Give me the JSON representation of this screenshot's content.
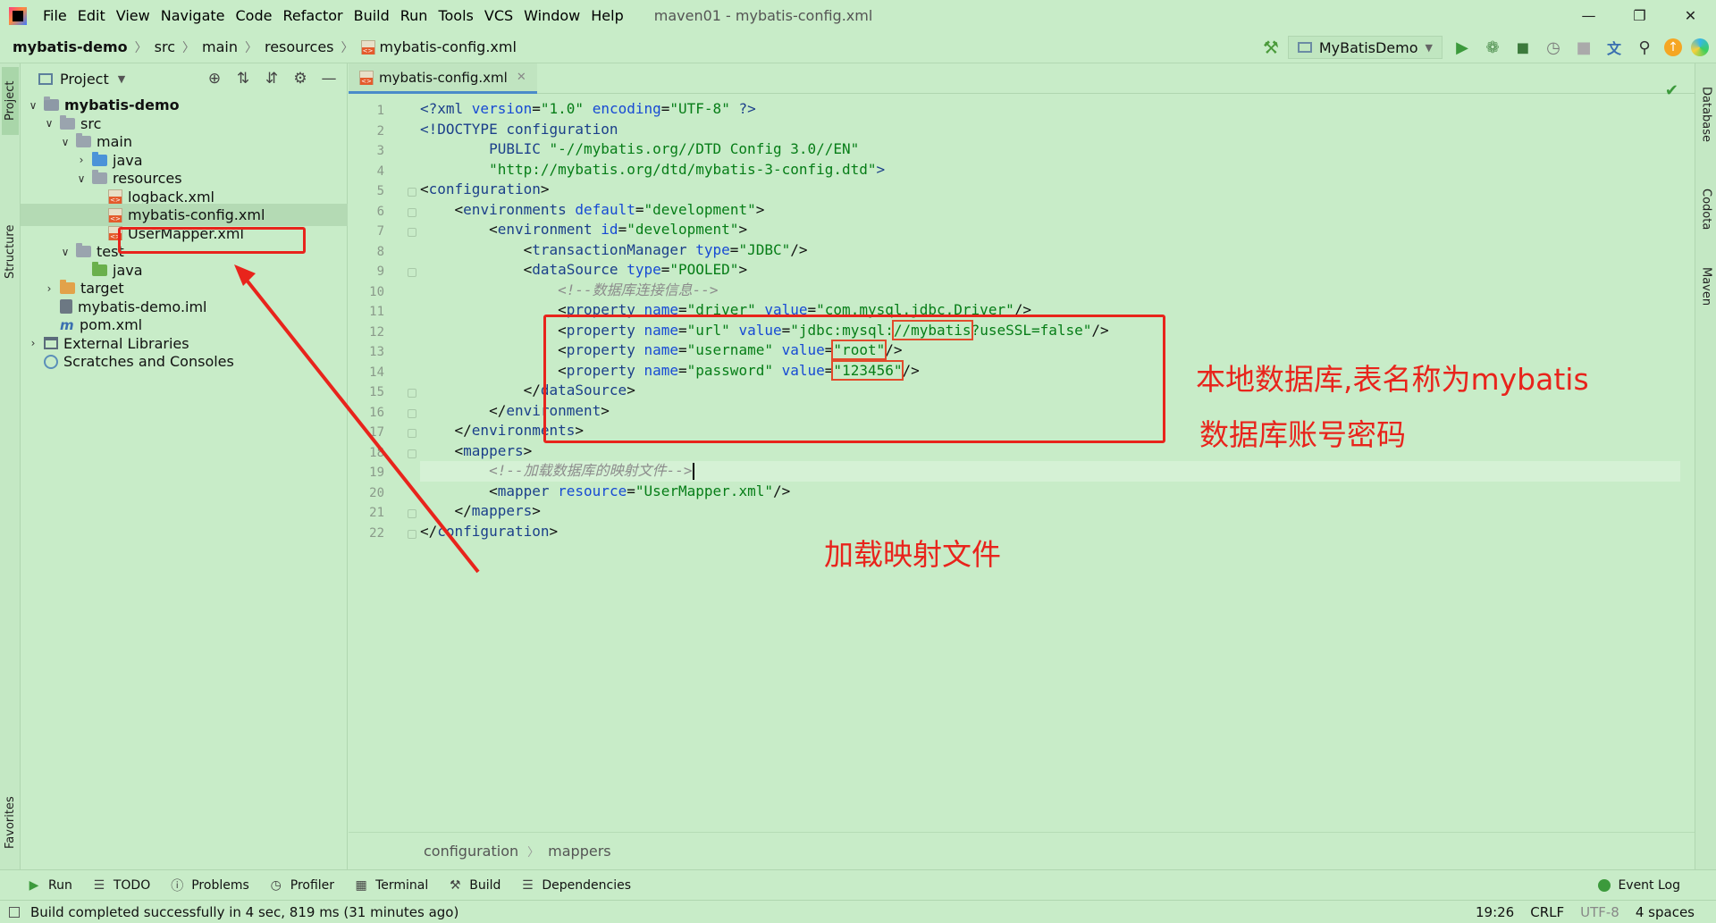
{
  "menubar": {
    "items": [
      "File",
      "Edit",
      "View",
      "Navigate",
      "Code",
      "Refactor",
      "Build",
      "Run",
      "Tools",
      "VCS",
      "Window",
      "Help"
    ],
    "window_title": "maven01 - mybatis-config.xml"
  },
  "navbar": {
    "crumbs": [
      "mybatis-demo",
      "src",
      "main",
      "resources",
      "mybatis-config.xml"
    ],
    "run_config": "MyBatisDemo"
  },
  "left_strip": {
    "project": "Project",
    "structure": "Structure",
    "favorites": "Favorites"
  },
  "right_strip": {
    "database": "Database",
    "codota": "Codota",
    "maven": "Maven"
  },
  "project_panel": {
    "title": "Project",
    "tree": [
      {
        "label": "mybatis-demo",
        "bold": true,
        "depth": 0,
        "expanded": true,
        "icon": "module-folder-icon"
      },
      {
        "label": "src",
        "depth": 1,
        "expanded": true,
        "icon": "folder-icon"
      },
      {
        "label": "main",
        "depth": 2,
        "expanded": true,
        "icon": "folder-icon"
      },
      {
        "label": "java",
        "depth": 3,
        "expanded": false,
        "icon": "source-folder-icon"
      },
      {
        "label": "resources",
        "depth": 3,
        "expanded": true,
        "icon": "resources-folder-icon"
      },
      {
        "label": "logback.xml",
        "depth": 4,
        "icon": "xml-file-icon"
      },
      {
        "label": "mybatis-config.xml",
        "depth": 4,
        "icon": "xml-file-icon",
        "selected": true
      },
      {
        "label": "UserMapper.xml",
        "depth": 4,
        "icon": "xml-file-icon"
      },
      {
        "label": "test",
        "depth": 2,
        "expanded": true,
        "icon": "folder-icon"
      },
      {
        "label": "java",
        "depth": 3,
        "icon": "test-folder-icon"
      },
      {
        "label": "target",
        "depth": 1,
        "expanded": false,
        "icon": "excluded-folder-icon"
      },
      {
        "label": "mybatis-demo.iml",
        "depth": 1,
        "icon": "iml-file-icon"
      },
      {
        "label": "pom.xml",
        "depth": 1,
        "icon": "maven-icon"
      },
      {
        "label": "External Libraries",
        "depth": 0,
        "expanded": false,
        "icon": "library-icon"
      },
      {
        "label": "Scratches and Consoles",
        "depth": 0,
        "icon": "scratch-icon"
      }
    ]
  },
  "editor": {
    "tab": "mybatis-config.xml",
    "current_line": 19,
    "lines": [
      [
        [
          "decl",
          "<?"
        ],
        [
          "tag",
          "xml "
        ],
        [
          "attr",
          "version"
        ],
        [
          "punct",
          "="
        ],
        [
          "val",
          "\"1.0\""
        ],
        [
          "punct",
          " "
        ],
        [
          "attr",
          "encoding"
        ],
        [
          "punct",
          "="
        ],
        [
          "val",
          "\"UTF-8\""
        ],
        [
          "punct",
          " "
        ],
        [
          "decl",
          "?>"
        ]
      ],
      [
        [
          "decl",
          "<!DOCTYPE "
        ],
        [
          "tag",
          "configuration"
        ]
      ],
      [
        [
          "punct",
          "        "
        ],
        [
          "tag",
          "PUBLIC "
        ],
        [
          "val",
          "\"-//mybatis.org//DTD Config 3.0//EN\""
        ]
      ],
      [
        [
          "punct",
          "        "
        ],
        [
          "val",
          "\"http://mybatis.org/dtd/mybatis-3-config.dtd\""
        ],
        [
          "decl",
          ">"
        ]
      ],
      [
        [
          "punct",
          "<"
        ],
        [
          "tag",
          "configuration"
        ],
        [
          "punct",
          ">"
        ]
      ],
      [
        [
          "punct",
          "    <"
        ],
        [
          "tag",
          "environments "
        ],
        [
          "attr",
          "default"
        ],
        [
          "punct",
          "="
        ],
        [
          "val",
          "\"development\""
        ],
        [
          "punct",
          ">"
        ]
      ],
      [
        [
          "punct",
          "        <"
        ],
        [
          "tag",
          "environment "
        ],
        [
          "attr",
          "id"
        ],
        [
          "punct",
          "="
        ],
        [
          "val",
          "\"development\""
        ],
        [
          "punct",
          ">"
        ]
      ],
      [
        [
          "punct",
          "            <"
        ],
        [
          "tag",
          "transactionManager "
        ],
        [
          "attr",
          "type"
        ],
        [
          "punct",
          "="
        ],
        [
          "val",
          "\"JDBC\""
        ],
        [
          "punct",
          "/>"
        ]
      ],
      [
        [
          "punct",
          "            <"
        ],
        [
          "tag",
          "dataSource "
        ],
        [
          "attr",
          "type"
        ],
        [
          "punct",
          "="
        ],
        [
          "val",
          "\"POOLED\""
        ],
        [
          "punct",
          ">"
        ]
      ],
      [
        [
          "punct",
          "                "
        ],
        [
          "comment",
          "<!--数据库连接信息-->"
        ]
      ],
      [
        [
          "punct",
          "                <"
        ],
        [
          "tag",
          "property "
        ],
        [
          "attr",
          "name"
        ],
        [
          "punct",
          "="
        ],
        [
          "val",
          "\"driver\""
        ],
        [
          "punct",
          " "
        ],
        [
          "attr",
          "value"
        ],
        [
          "punct",
          "="
        ],
        [
          "val",
          "\"com.mysql.jdbc.Driver\""
        ],
        [
          "punct",
          "/>"
        ]
      ],
      [
        [
          "punct",
          "                <"
        ],
        [
          "tag",
          "property "
        ],
        [
          "attr",
          "name"
        ],
        [
          "punct",
          "="
        ],
        [
          "val",
          "\"url\""
        ],
        [
          "punct",
          " "
        ],
        [
          "attr",
          "value"
        ],
        [
          "punct",
          "="
        ],
        [
          "val",
          "\"jdbc:mysql:"
        ],
        [
          "valbox",
          "//mybatis"
        ],
        [
          "val",
          "?useSSL=false\""
        ],
        [
          "punct",
          "/>"
        ]
      ],
      [
        [
          "punct",
          "                <"
        ],
        [
          "tag",
          "property "
        ],
        [
          "attr",
          "name"
        ],
        [
          "punct",
          "="
        ],
        [
          "val",
          "\"username\""
        ],
        [
          "punct",
          " "
        ],
        [
          "attr",
          "value"
        ],
        [
          "punct",
          "="
        ],
        [
          "valbox",
          "\"root\""
        ],
        [
          "punct",
          "/>"
        ]
      ],
      [
        [
          "punct",
          "                <"
        ],
        [
          "tag",
          "property "
        ],
        [
          "attr",
          "name"
        ],
        [
          "punct",
          "="
        ],
        [
          "val",
          "\"password\""
        ],
        [
          "punct",
          " "
        ],
        [
          "attr",
          "value"
        ],
        [
          "punct",
          "="
        ],
        [
          "valbox",
          "\"123456\""
        ],
        [
          "punct",
          "/>"
        ]
      ],
      [
        [
          "punct",
          "            </"
        ],
        [
          "tag",
          "dataSource"
        ],
        [
          "punct",
          ">"
        ]
      ],
      [
        [
          "punct",
          "        </"
        ],
        [
          "tag",
          "environment"
        ],
        [
          "punct",
          ">"
        ]
      ],
      [
        [
          "punct",
          "    </"
        ],
        [
          "tag",
          "environments"
        ],
        [
          "punct",
          ">"
        ]
      ],
      [
        [
          "punct",
          "    <"
        ],
        [
          "tag",
          "mappers"
        ],
        [
          "punct",
          ">"
        ]
      ],
      [
        [
          "punct",
          "        "
        ],
        [
          "comment",
          "<!--加载数据库的映射文件-->"
        ],
        [
          "caret",
          ""
        ]
      ],
      [
        [
          "punct",
          "        <"
        ],
        [
          "tag",
          "mapper "
        ],
        [
          "attr",
          "resource"
        ],
        [
          "punct",
          "="
        ],
        [
          "val",
          "\"UserMapper.xml\""
        ],
        [
          "punct",
          "/>"
        ]
      ],
      [
        [
          "punct",
          "    </"
        ],
        [
          "tag",
          "mappers"
        ],
        [
          "punct",
          ">"
        ]
      ],
      [
        [
          "punct",
          "</"
        ],
        [
          "tag",
          "configuration"
        ],
        [
          "punct",
          ">"
        ]
      ]
    ],
    "breadcrumb": [
      "configuration",
      "mappers"
    ]
  },
  "bottom_tools": [
    "Run",
    "TODO",
    "Problems",
    "Profiler",
    "Terminal",
    "Build",
    "Dependencies"
  ],
  "event_log": "Event Log",
  "status": {
    "message": "Build completed successfully in 4 sec, 819 ms (31 minutes ago)",
    "position": "19:26",
    "line_sep": "CRLF",
    "encoding": "UTF-8",
    "indent": "4 spaces"
  },
  "annotations": {
    "db_name_note": "本地数据库,表名称为mybatis",
    "credentials_note": "数据库账号密码",
    "mapping_note": "加载映射文件"
  },
  "colors": {
    "theme_bg": "#c8ecc8",
    "annotation_red": "#e8241c"
  }
}
